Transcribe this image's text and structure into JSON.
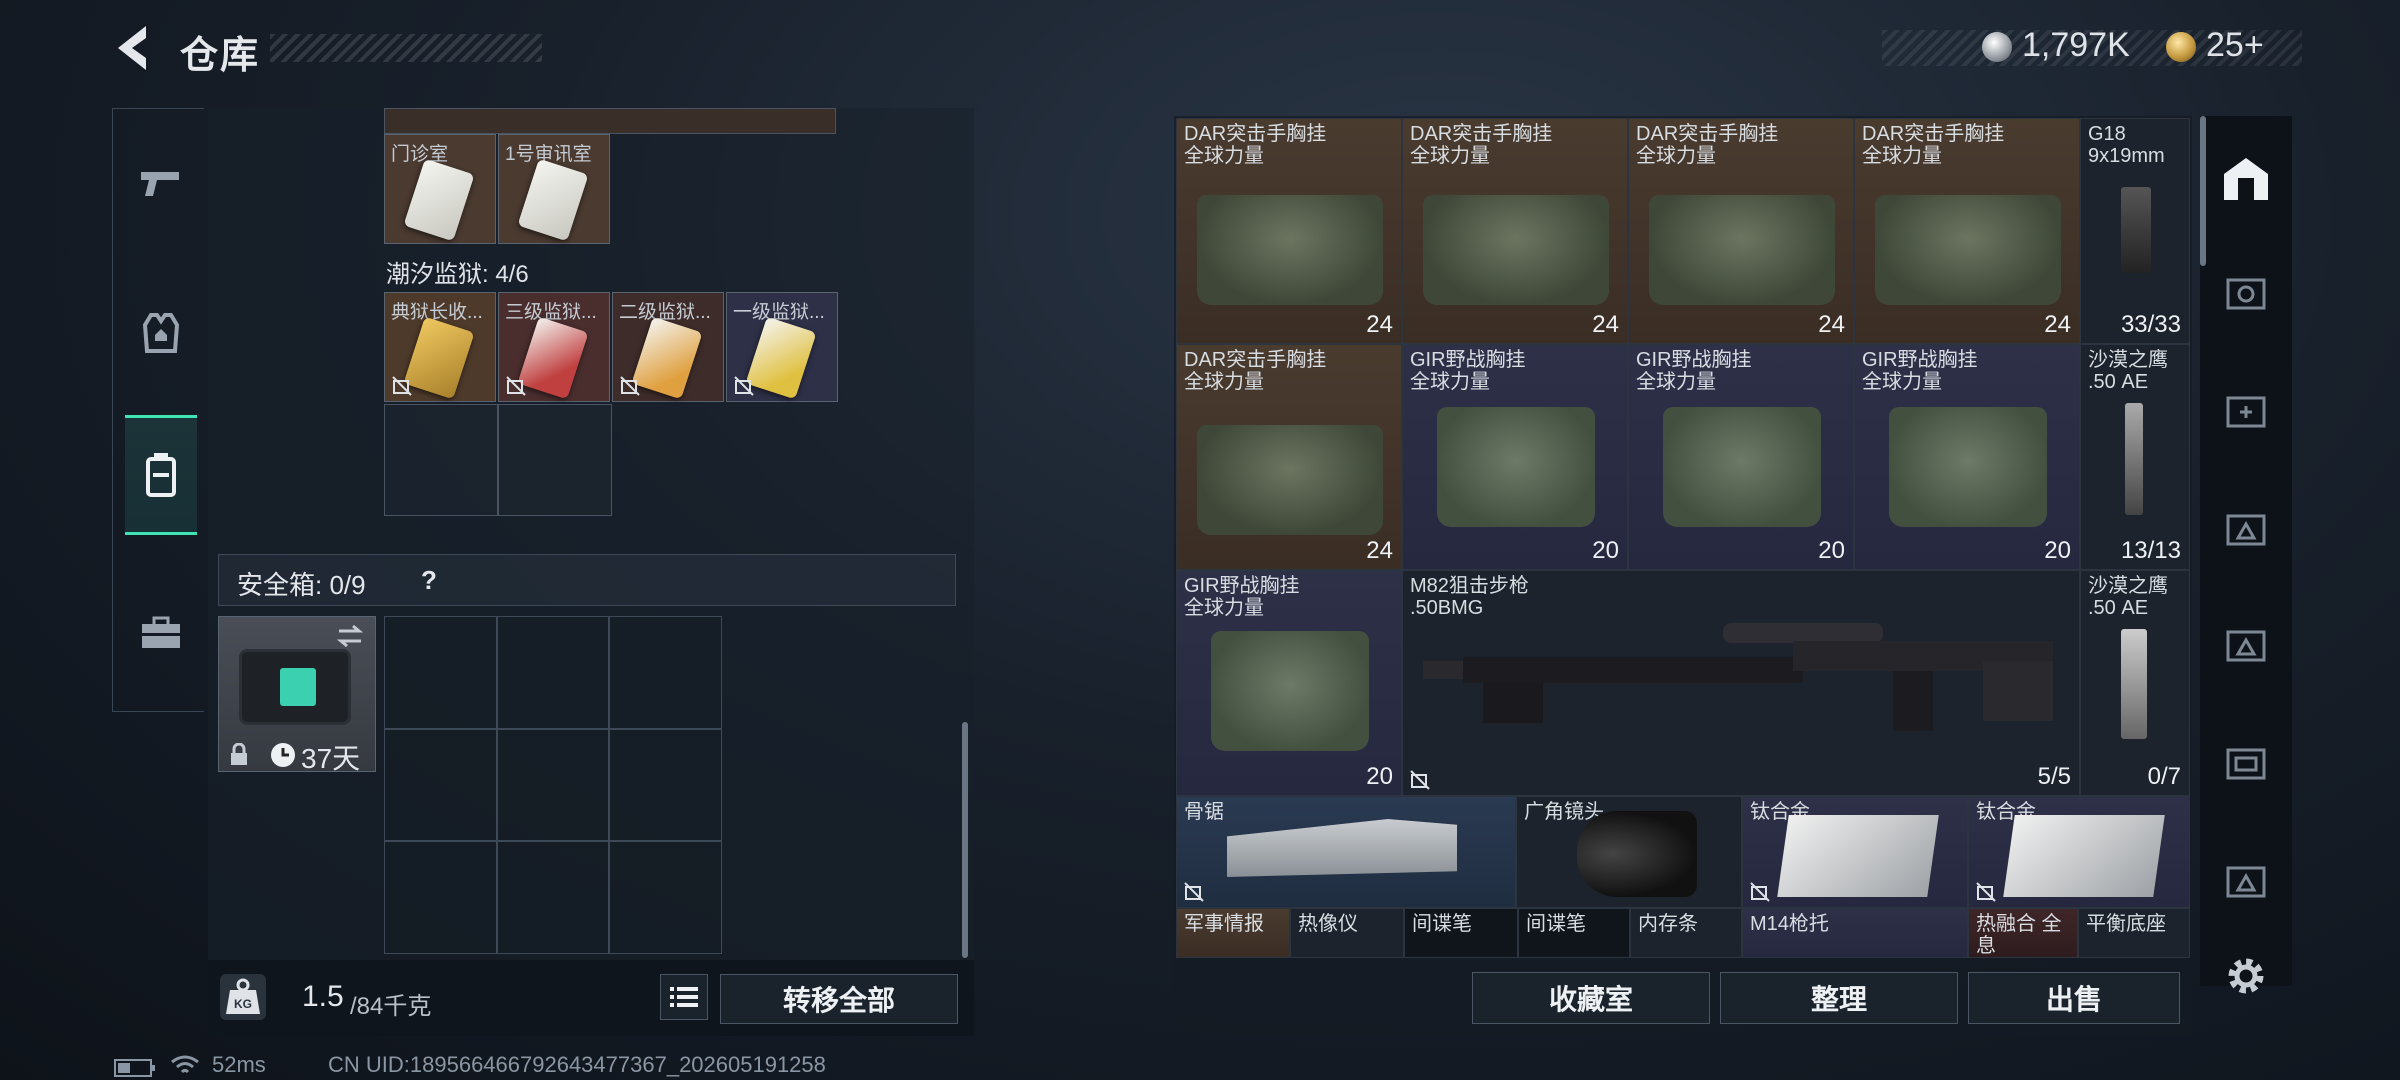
{
  "header": {
    "title": "仓库"
  },
  "currency": {
    "silver": "1,797K",
    "gold": "25+"
  },
  "left": {
    "top_cards": [
      {
        "label": "门诊室"
      },
      {
        "label": "1号审讯室"
      }
    ],
    "prison_section": "潮汐监狱: 4/6",
    "prison_cards": [
      {
        "label": "典狱长收..."
      },
      {
        "label": "三级监狱..."
      },
      {
        "label": "二级监狱..."
      },
      {
        "label": "一级监狱..."
      }
    ],
    "safe_box": {
      "label": "安全箱: 0/9",
      "help": "?",
      "days": "37天"
    },
    "weight": {
      "value": "1.5",
      "max": "/84千克"
    },
    "transfer_all": "转移全部"
  },
  "right": {
    "items": [
      {
        "name": "DAR突击手胸挂\n全球力量",
        "count": "24"
      },
      {
        "name": "DAR突击手胸挂\n全球力量",
        "count": "24"
      },
      {
        "name": "DAR突击手胸挂\n全球力量",
        "count": "24"
      },
      {
        "name": "DAR突击手胸挂\n全球力量",
        "count": "24"
      },
      {
        "name": "G18\n9x19mm",
        "count": "33/33"
      },
      {
        "name": "DAR突击手胸挂\n全球力量",
        "count": "24"
      },
      {
        "name": "GIR野战胸挂\n全球力量",
        "count": "20"
      },
      {
        "name": "GIR野战胸挂\n全球力量",
        "count": "20"
      },
      {
        "name": "GIR野战胸挂\n全球力量",
        "count": "20"
      },
      {
        "name": "沙漠之鹰\n.50 AE",
        "count": "13/13"
      },
      {
        "name": "GIR野战胸挂\n全球力量",
        "count": "20"
      },
      {
        "name": "M82狙击步枪\n.50BMG",
        "count": "5/5"
      },
      {
        "name": "沙漠之鹰\n.50 AE",
        "count": "0/7"
      },
      {
        "name": "骨锯"
      },
      {
        "name": "广角镜头"
      },
      {
        "name": "钛合金"
      },
      {
        "name": "钛合金"
      },
      {
        "name": "军事情报"
      },
      {
        "name": "热像仪"
      },
      {
        "name": "间谍笔"
      },
      {
        "name": "间谍笔"
      },
      {
        "name": "内存条"
      },
      {
        "name": "M14枪托"
      },
      {
        "name": "热融合 全息"
      },
      {
        "name": "平衡底座"
      }
    ],
    "buttons": {
      "collection": "收藏室",
      "sort": "整理",
      "sell": "出售"
    }
  },
  "status": {
    "ping": "52ms",
    "uid": "CN UID:189566466792643477367_202605191258"
  }
}
